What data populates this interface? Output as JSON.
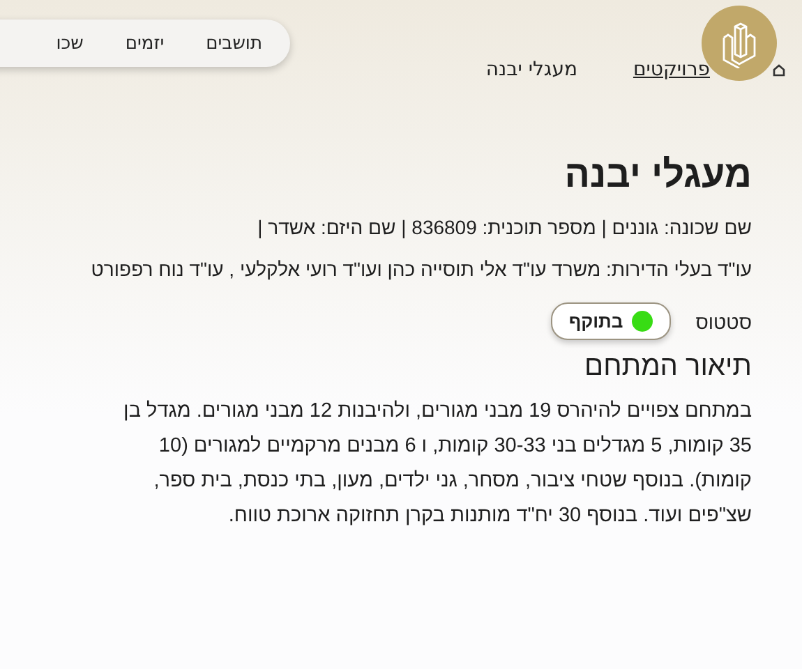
{
  "nav": {
    "items": [
      {
        "label": "תושבים",
        "selected": false
      },
      {
        "label": "יזמים",
        "selected": false
      },
      {
        "label": "שכו",
        "selected": false
      }
    ]
  },
  "breadcrumb": [
    {
      "label": "פרויקטים",
      "kind": "link"
    },
    {
      "label": "מעגלי יבנה",
      "kind": "current"
    }
  ],
  "title": "מעגלי יבנה",
  "details": [
    "שם שכונה: גוננים | מספר תוכנית: 836809 | שם היזם: אשדר |",
    "עו\"ד בעלי הדירות: משרד עו\"ד אלי תוסייה כהן ועו\"ד רועי אלקלעי , עו\"ד נוח רפפורט"
  ],
  "status": {
    "label": "סטטוס",
    "value": "בתוקף",
    "valid": true
  },
  "description": {
    "heading": "תיאור המתחם",
    "text": "במתחם צפויים להיהרס 19 מבני מגורים, ולהיבנות 12 מבני מגורים. מגדל בן 35 קומות, 5 מגדלים בני 30-33 קומות, ו 6 מבנים מרקמיים למגורים (10 קומות). בנוסף שטחי ציבור, מסחר, גני ילדים, מעון, בתי כנסת, בית ספר, שצ\"פים ועוד. בנוסף 30 יח\"ד מותנות בקרן תחזוקה ארוכת טווח."
  }
}
